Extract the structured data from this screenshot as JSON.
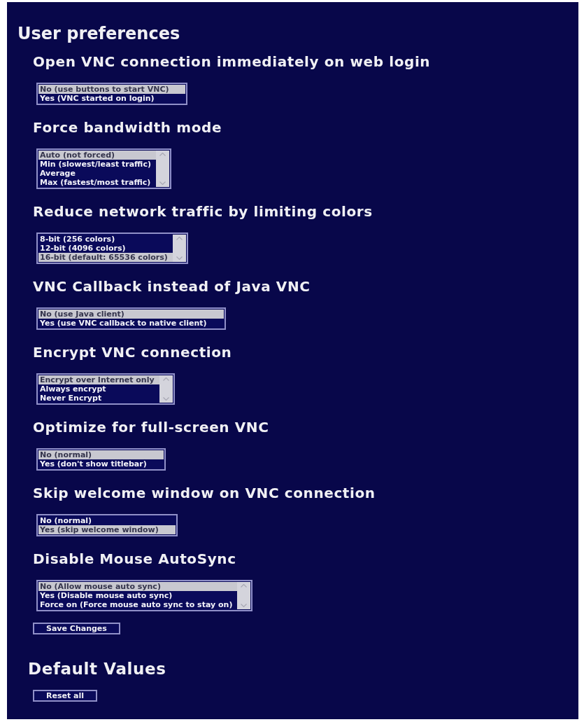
{
  "title": "User preferences",
  "preferences": [
    {
      "heading": "Open VNC connection immediately on web login",
      "scrollbar": false,
      "options": [
        {
          "label": "No (use buttons to start VNC)",
          "selected": true
        },
        {
          "label": "Yes (VNC started on login)",
          "selected": false
        }
      ]
    },
    {
      "heading": "Force bandwidth mode",
      "scrollbar": true,
      "options": [
        {
          "label": "Auto (not forced)",
          "selected": true
        },
        {
          "label": "Min (slowest/least traffic)",
          "selected": false
        },
        {
          "label": "Average",
          "selected": false
        },
        {
          "label": "Max (fastest/most traffic)",
          "selected": false
        }
      ]
    },
    {
      "heading": "Reduce network traffic by limiting colors",
      "scrollbar": true,
      "options": [
        {
          "label": "8-bit (256 colors)",
          "selected": false
        },
        {
          "label": "12-bit (4096 colors)",
          "selected": false
        },
        {
          "label": "16-bit (default: 65536 colors)",
          "selected": true
        }
      ]
    },
    {
      "heading": "VNC Callback instead of Java VNC",
      "scrollbar": false,
      "options": [
        {
          "label": "No (use Java client)",
          "selected": true
        },
        {
          "label": "Yes (use VNC callback to native client)",
          "selected": false
        }
      ]
    },
    {
      "heading": "Encrypt VNC connection",
      "scrollbar": true,
      "options": [
        {
          "label": "Encrypt over Internet only",
          "selected": true
        },
        {
          "label": "Always encrypt",
          "selected": false
        },
        {
          "label": "Never Encrypt",
          "selected": false
        }
      ]
    },
    {
      "heading": "Optimize for full-screen VNC",
      "scrollbar": false,
      "options": [
        {
          "label": "No (normal)",
          "selected": true
        },
        {
          "label": "Yes (don't show titlebar)",
          "selected": false
        }
      ]
    },
    {
      "heading": "Skip welcome window on VNC connection",
      "scrollbar": false,
      "options": [
        {
          "label": "No (normal)",
          "selected": false
        },
        {
          "label": "Yes (skip welcome window)",
          "selected": true
        }
      ]
    },
    {
      "heading": "Disable Mouse AutoSync",
      "scrollbar": true,
      "options": [
        {
          "label": "No (Allow mouse auto sync)",
          "selected": true
        },
        {
          "label": "Yes (Disable mouse auto sync)",
          "selected": false
        },
        {
          "label": "Force on (Force mouse auto sync to stay on)",
          "selected": false
        }
      ]
    }
  ],
  "save_button": "Save Changes",
  "defaults": {
    "heading": "Default Values",
    "reset_button": "Reset all"
  }
}
